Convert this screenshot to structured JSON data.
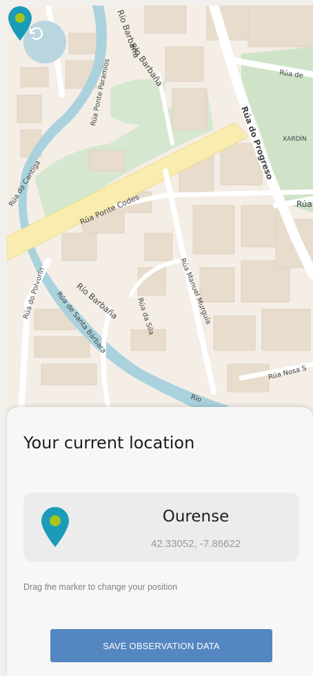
{
  "map": {
    "streets": [
      {
        "label": "Río Barbaña"
      },
      {
        "label": "Rúa Ponte Paramios"
      },
      {
        "label": "Río Barbaña"
      },
      {
        "label": "Rúa de"
      },
      {
        "label": "Rúa do Progreso"
      },
      {
        "label": "XARDÍN"
      },
      {
        "label": "Rúa"
      },
      {
        "label": "Rúa da Cantiga"
      },
      {
        "label": "Rúa Ponte Codes"
      },
      {
        "label": "Rúa do Polvorín"
      },
      {
        "label": "Rúa de Santa Bárbara"
      },
      {
        "label": "Río Barbaña"
      },
      {
        "label": "Rúa da Sila"
      },
      {
        "label": "Rúa Manuel Murguía"
      },
      {
        "label": "Rúa Nosa S"
      },
      {
        "label": "Río"
      }
    ],
    "back_icon": "undo-arrow-icon",
    "pin_icon": "map-marker-icon"
  },
  "colors": {
    "marker": "#1a9bb8",
    "marker_dot": "#a6c41a",
    "button": "#5487c1",
    "river": "#a9d2dd",
    "park": "#cfe3c9",
    "road_main": "#f8ecae"
  },
  "sheet": {
    "title": "Your current location",
    "location": {
      "city": "Ourense",
      "coords": "42.33052, -7.86622"
    },
    "hint": "Drag the marker to change your position",
    "save_label": "SAVE OBSERVATION DATA"
  }
}
